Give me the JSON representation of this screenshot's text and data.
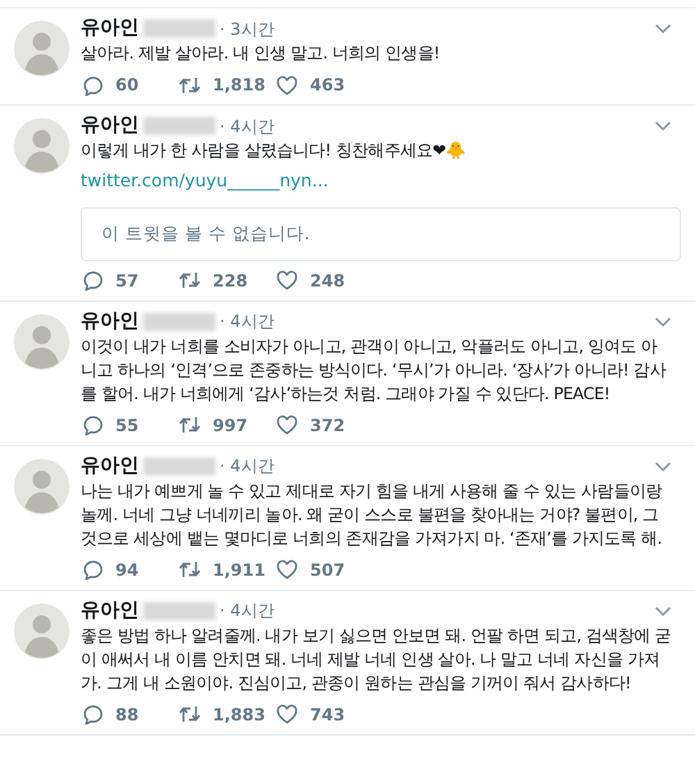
{
  "tweets": [
    {
      "name": "유아인",
      "time": "· 3시간",
      "text": "살아라. 제발 살아라. 내 인생 말고. 너희의 인생을!",
      "replies": "60",
      "retweets": "1,818",
      "likes": "463"
    },
    {
      "name": "유아인",
      "time": "· 4시간",
      "text": "이렇게 내가 한 사람을 살렸습니다! 칭찬해주세요❤🐥",
      "link": "twitter.com/yuyu______nyn...",
      "quote": "이 트윗을 볼 수 없습니다.",
      "replies": "57",
      "retweets": "228",
      "likes": "248"
    },
    {
      "name": "유아인",
      "time": "· 4시간",
      "text": "이것이 내가 너희를 소비자가 아니고, 관객이 아니고, 악플러도 아니고, 잉여도 아니고 하나의 ‘인격’으로 존중하는 방식이다. ‘무시’가 아니라. ‘장사’가 아니라! 감사를 할어. 내가 너희에게 ‘감사’하는것 처럼. 그래야 가질 수 있단다. PEACE!",
      "replies": "55",
      "retweets": "997",
      "likes": "372"
    },
    {
      "name": "유아인",
      "time": "· 4시간",
      "text": "나는 내가 예쁘게 놀 수 있고 제대로 자기 힘을 내게 사용해 줄 수 있는 사람들이랑 놀께. 너네 그냥 너네끼리 놀아. 왜 굳이 스스로 불편을 찾아내는 거야? 불편이, 그것으로 세상에 뱉는 몇마디로 너희의 존재감을 가져가지 마. ‘존재’를 가지도록 해.",
      "replies": "94",
      "retweets": "1,911",
      "likes": "507"
    },
    {
      "name": "유아인",
      "time": "· 4시간",
      "text": "좋은 방법 하나 알려줄께. 내가 보기 싫으면 안보면 돼. 언팔 하면 되고, 검색창에 굳이 애써서 내 이름 안치면 돼. 너네 제발 너네 인생 살아. 나 말고 너네 자신을 가져가. 그게 내 소원이야. 진심이고, 관종이 원하는 관심을 기꺼이 줘서 감사하다!",
      "replies": "88",
      "retweets": "1,883",
      "likes": "743"
    }
  ]
}
